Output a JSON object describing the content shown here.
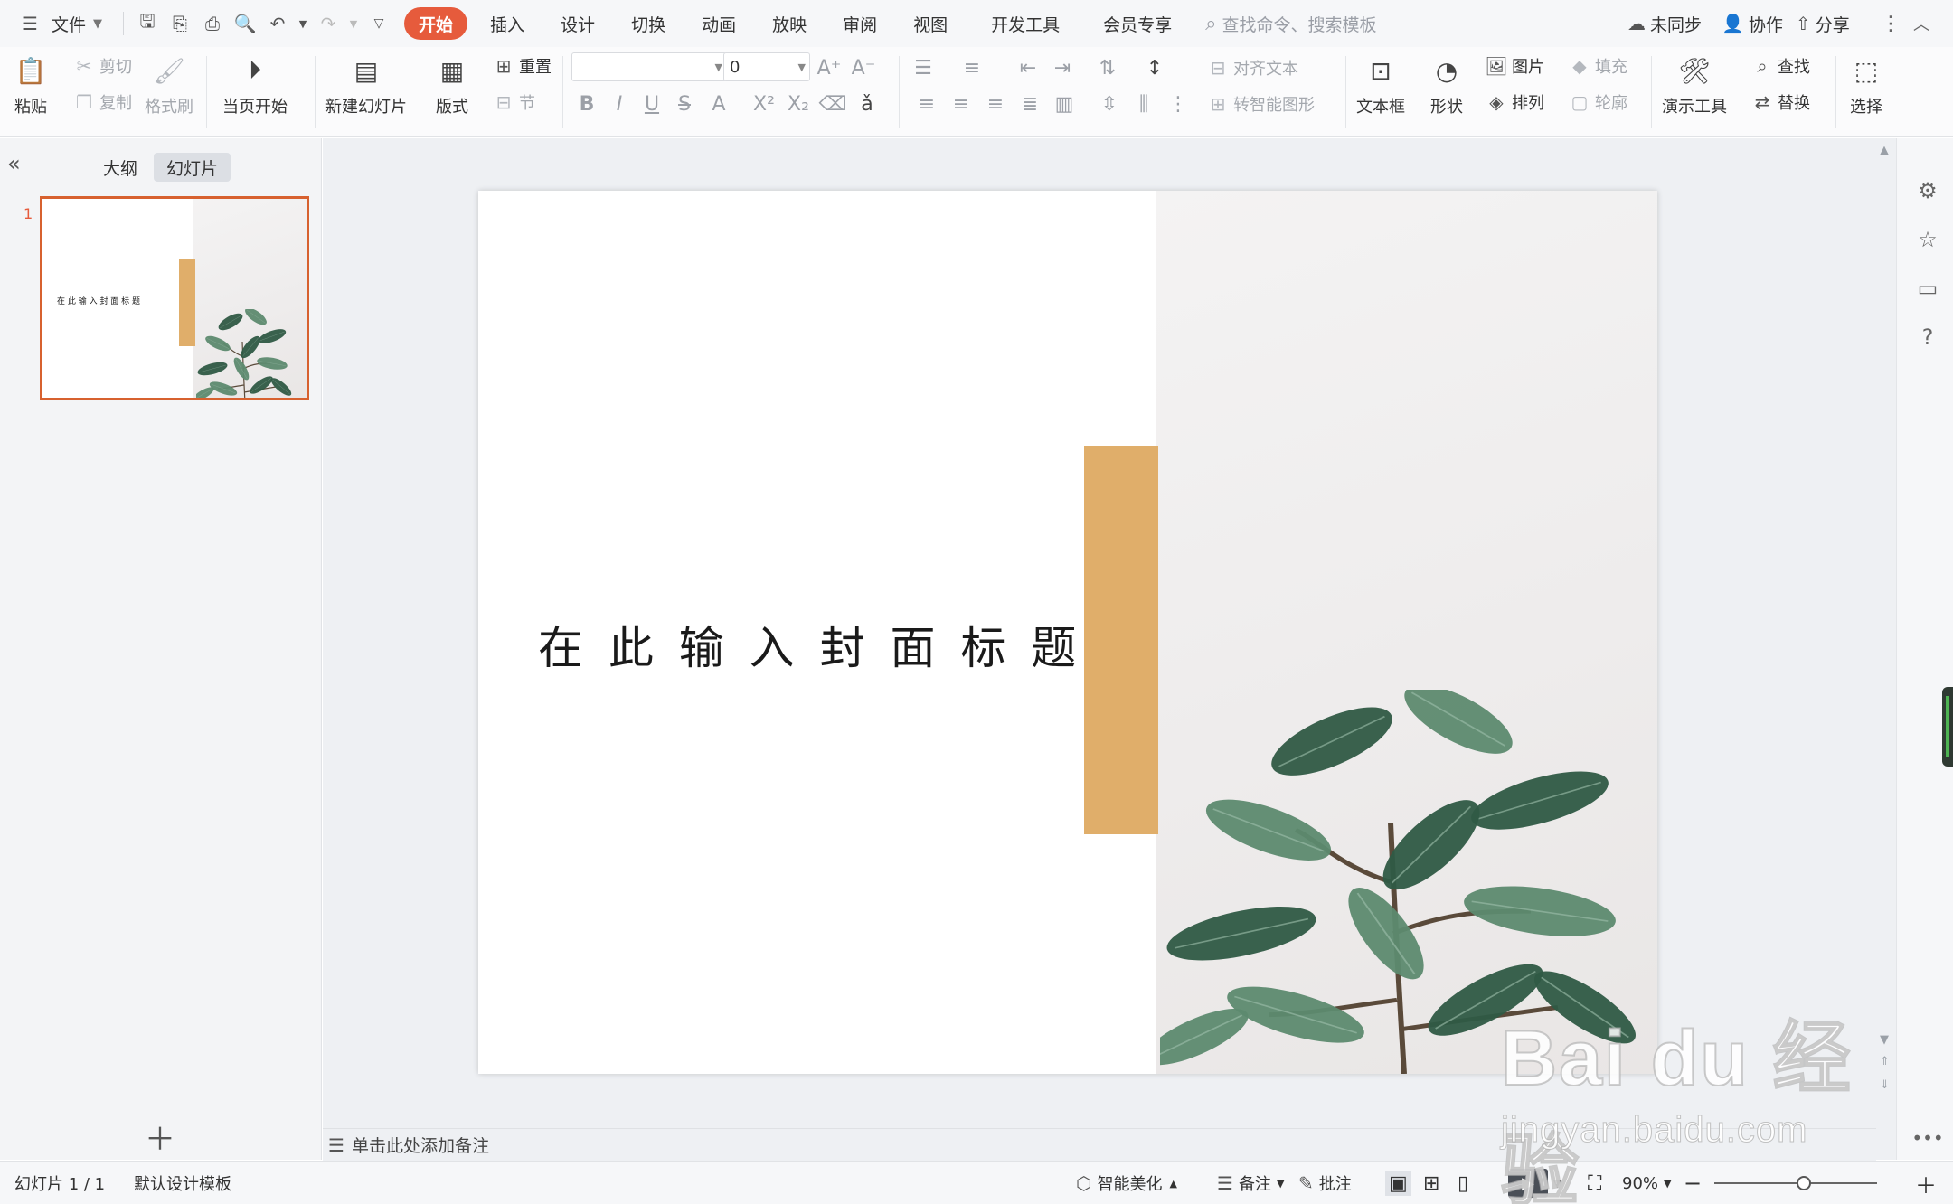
{
  "menubar": {
    "file": "文件",
    "tabs": [
      "开始",
      "插入",
      "设计",
      "切换",
      "动画",
      "放映",
      "审阅",
      "视图",
      "开发工具",
      "会员专享"
    ],
    "active_tab": "开始",
    "search_placeholder": "查找命令、搜索模板",
    "sync": "未同步",
    "collab": "协作",
    "share": "分享"
  },
  "ribbon": {
    "paste": "粘贴",
    "cut": "剪切",
    "copy": "复制",
    "format_painter": "格式刷",
    "from_current": "当页开始",
    "new_slide": "新建幻灯片",
    "layout": "版式",
    "reset": "重置",
    "section": "节",
    "font_name": "",
    "font_size": "0",
    "align_text": "对齐文本",
    "to_smartart": "转智能图形",
    "textbox": "文本框",
    "shape": "形状",
    "picture": "图片",
    "arrange": "排列",
    "fill": "填充",
    "outline": "轮廓",
    "presentation_tools": "演示工具",
    "find": "查找",
    "replace": "替换",
    "select": "选择"
  },
  "left_panel": {
    "tab_outline": "大纲",
    "tab_slides": "幻灯片",
    "active_tab": "幻灯片",
    "slide_number": "1"
  },
  "slide": {
    "title": "在 此 输 入 封 面 标 题",
    "accent_color": "#e0ae6a"
  },
  "notes_placeholder": "单击此处添加备注",
  "statusbar": {
    "slide_counter": "幻灯片 1 / 1",
    "template": "默认设计模板",
    "smart_beautify": "智能美化",
    "notes": "备注",
    "comments": "批注",
    "zoom": "90%",
    "zoom_level": 0.55
  },
  "watermark": {
    "brand": "Bai du 经验",
    "url": "jingyan.baidu.com"
  },
  "colors": {
    "active_tab": "#e65b3c",
    "thumb_border": "#d7612f",
    "leaf_dark": "#2f5a45",
    "leaf_light": "#5d8a6f"
  }
}
